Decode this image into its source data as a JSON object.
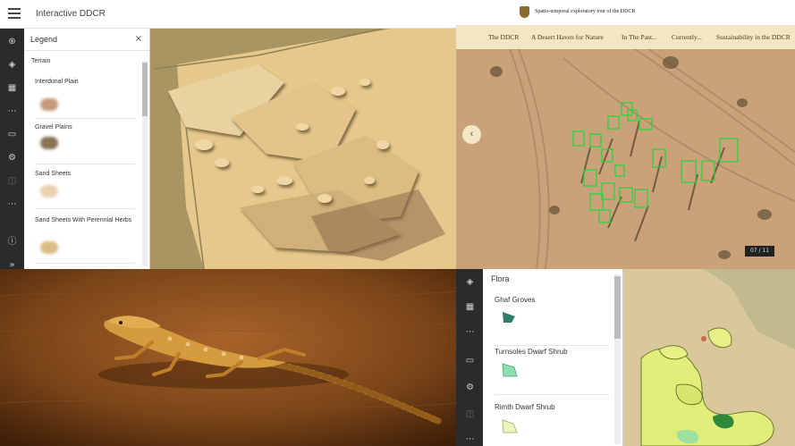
{
  "map_app": {
    "title": "Interactive DDCR",
    "legend": {
      "title": "Legend",
      "close_glyph": "×",
      "group": "Terrain",
      "items": [
        {
          "label": "Interdunal Plain",
          "color": "#c69a7a"
        },
        {
          "label": "Gravel Plains",
          "color": "#8a7256"
        },
        {
          "label": "Sand Sheets",
          "color": "#e8d2b0"
        },
        {
          "label": "Sand Sheets With Perennial Herbs",
          "color": "#d8bd84"
        }
      ]
    },
    "rail_icons": [
      "add-icon",
      "layers-icon",
      "table-icon",
      "more-icon",
      "card-icon",
      "settings-icon",
      "export-icon",
      "more-icon",
      "info-icon",
      "expand-icon"
    ]
  },
  "story_site": {
    "title": "Spatio-temporal exploratory tour of the DDCR",
    "nav": [
      "The DDCR",
      "A Desert Haven for Nature",
      "In The Past...",
      "Currently...",
      "Sustainability in the DDCR"
    ],
    "prev_glyph": "‹",
    "counter": "07 / 11"
  },
  "flora_app": {
    "title": "Flora",
    "items": [
      {
        "label": "Ghaf Groves",
        "color": "#2e7d6a"
      },
      {
        "label": "Turnsoles Dwarf Shrub",
        "color": "#8fe0b0"
      },
      {
        "label": "Rimth Dwarf Shrub",
        "color": "#eaf5c0"
      }
    ]
  }
}
